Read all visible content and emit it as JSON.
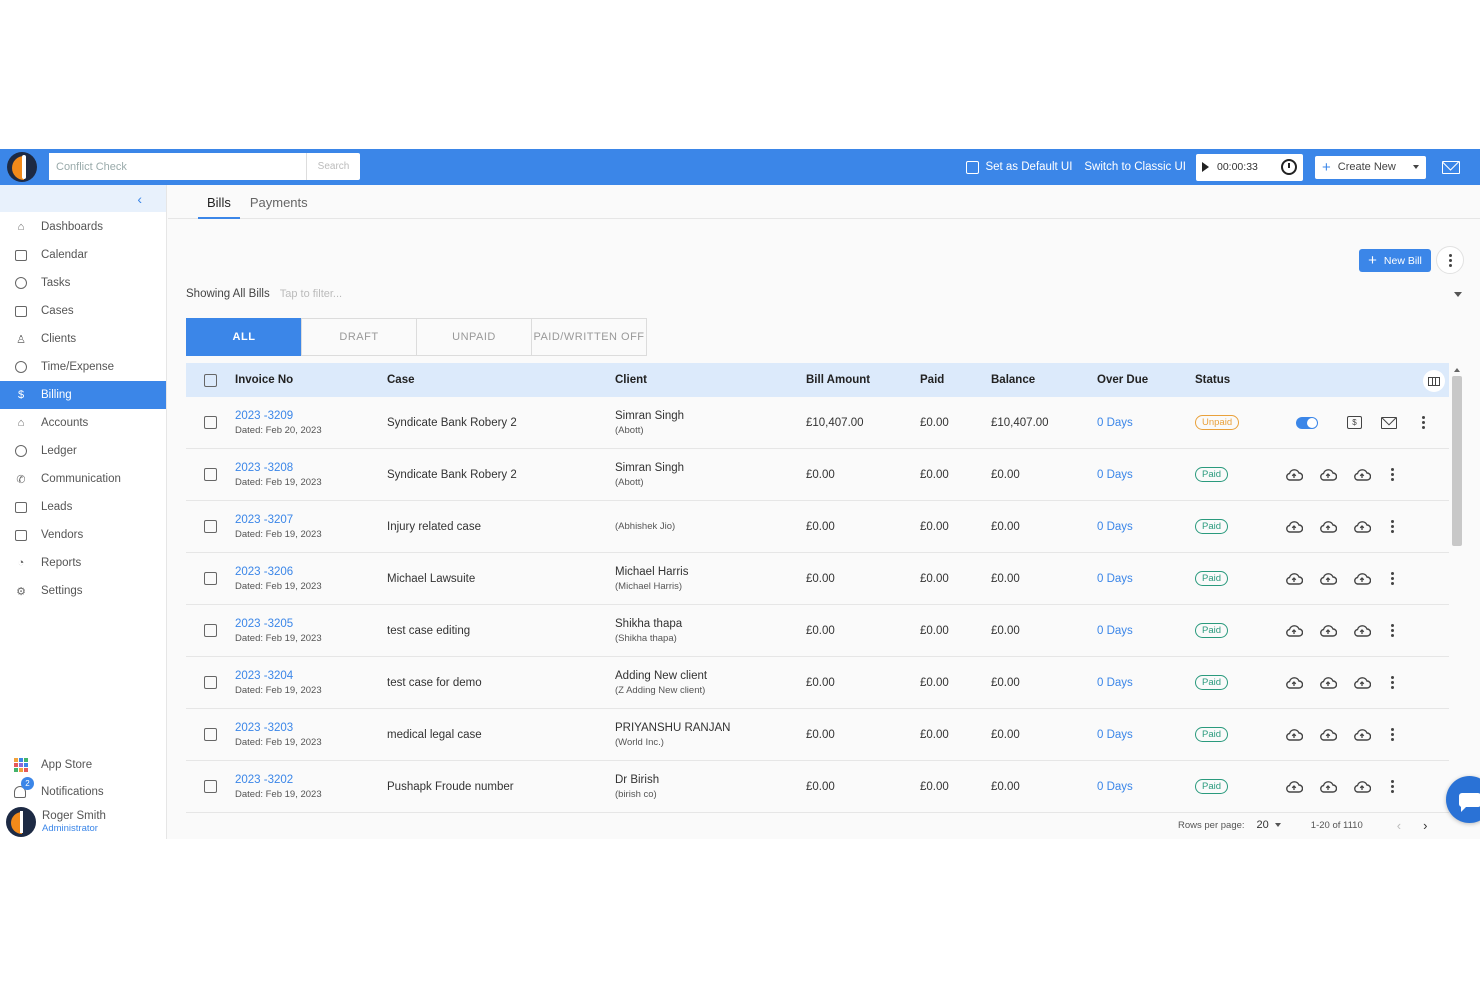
{
  "topbar": {
    "search_placeholder": "Conflict Check",
    "search_button": "Search",
    "set_default_label": "Set as Default UI",
    "switch_classic_label": "Switch to Classic UI",
    "timer_value": "00:00:33",
    "create_new_label": "Create New",
    "accent_color": "#3b86e8"
  },
  "sidebar": {
    "items": [
      {
        "label": "Dashboards",
        "icon": "home-icon"
      },
      {
        "label": "Calendar",
        "icon": "calendar-icon"
      },
      {
        "label": "Tasks",
        "icon": "check-circle-icon"
      },
      {
        "label": "Cases",
        "icon": "briefcase-icon"
      },
      {
        "label": "Clients",
        "icon": "user-icon"
      },
      {
        "label": "Time/Expense",
        "icon": "clock-icon"
      },
      {
        "label": "Billing",
        "icon": "dollar-icon",
        "active": true
      },
      {
        "label": "Accounts",
        "icon": "bank-icon"
      },
      {
        "label": "Ledger",
        "icon": "ledger-icon"
      },
      {
        "label": "Communication",
        "icon": "phone-icon"
      },
      {
        "label": "Leads",
        "icon": "card-icon"
      },
      {
        "label": "Vendors",
        "icon": "store-icon"
      },
      {
        "label": "Reports",
        "icon": "chart-icon"
      },
      {
        "label": "Settings",
        "icon": "gear-icon"
      }
    ],
    "app_store_label": "App Store",
    "notifications_label": "Notifications",
    "notifications_count": "2",
    "user_name": "Roger Smith",
    "user_role": "Administrator"
  },
  "main": {
    "tabs": [
      {
        "label": "Bills",
        "active": true
      },
      {
        "label": "Payments",
        "active": false
      }
    ],
    "new_bill_label": "New Bill",
    "showing_label": "Showing All Bills",
    "filter_placeholder": "Tap to filter...",
    "segments": [
      {
        "label": "ALL",
        "active": true
      },
      {
        "label": "DRAFT",
        "active": false
      },
      {
        "label": "UNPAID",
        "active": false
      },
      {
        "label": "PAID/WRITTEN OFF",
        "active": false
      }
    ],
    "columns": [
      "Invoice No",
      "Case",
      "Client",
      "Bill Amount",
      "Paid",
      "Balance",
      "Over Due",
      "Status"
    ],
    "rows": [
      {
        "invoice": "2023 -3209",
        "date": "Dated: Feb 20, 2023",
        "case": "Syndicate Bank Robery 2",
        "client": "Simran Singh",
        "client_sub": "(Abott)",
        "amount": "£10,407.00",
        "paid": "£0.00",
        "balance": "£10,407.00",
        "overdue": "0 Days",
        "status": "Unpaid"
      },
      {
        "invoice": "2023 -3208",
        "date": "Dated: Feb 19, 2023",
        "case": "Syndicate Bank Robery 2",
        "client": "Simran Singh",
        "client_sub": "(Abott)",
        "amount": "£0.00",
        "paid": "£0.00",
        "balance": "£0.00",
        "overdue": "0 Days",
        "status": "Paid"
      },
      {
        "invoice": "2023 -3207",
        "date": "Dated: Feb 19, 2023",
        "case": "Injury related case",
        "client": "",
        "client_sub": "(Abhishek Jio)",
        "amount": "£0.00",
        "paid": "£0.00",
        "balance": "£0.00",
        "overdue": "0 Days",
        "status": "Paid"
      },
      {
        "invoice": "2023 -3206",
        "date": "Dated: Feb 19, 2023",
        "case": "Michael Lawsuite",
        "client": "Michael Harris",
        "client_sub": "(Michael Harris)",
        "amount": "£0.00",
        "paid": "£0.00",
        "balance": "£0.00",
        "overdue": "0 Days",
        "status": "Paid"
      },
      {
        "invoice": "2023 -3205",
        "date": "Dated: Feb 19, 2023",
        "case": "test case editing",
        "client": "Shikha thapa",
        "client_sub": "(Shikha thapa)",
        "amount": "£0.00",
        "paid": "£0.00",
        "balance": "£0.00",
        "overdue": "0 Days",
        "status": "Paid"
      },
      {
        "invoice": "2023 -3204",
        "date": "Dated: Feb 19, 2023",
        "case": "test case for demo",
        "client": "Adding New client",
        "client_sub": "(Z Adding New client)",
        "amount": "£0.00",
        "paid": "£0.00",
        "balance": "£0.00",
        "overdue": "0 Days",
        "status": "Paid"
      },
      {
        "invoice": "2023 -3203",
        "date": "Dated: Feb 19, 2023",
        "case": "medical legal case",
        "client": "PRIYANSHU RANJAN",
        "client_sub": "(World Inc.)",
        "amount": "£0.00",
        "paid": "£0.00",
        "balance": "£0.00",
        "overdue": "0 Days",
        "status": "Paid"
      },
      {
        "invoice": "2023 -3202",
        "date": "Dated: Feb 19, 2023",
        "case": "Pushapk Froude number",
        "client": "Dr Birish",
        "client_sub": "(birish co)",
        "amount": "£0.00",
        "paid": "£0.00",
        "balance": "£0.00",
        "overdue": "0 Days",
        "status": "Paid"
      }
    ],
    "pager": {
      "rows_per_page_label": "Rows per page:",
      "rows_per_page_value": "20",
      "range": "1-20 of 1110"
    }
  }
}
